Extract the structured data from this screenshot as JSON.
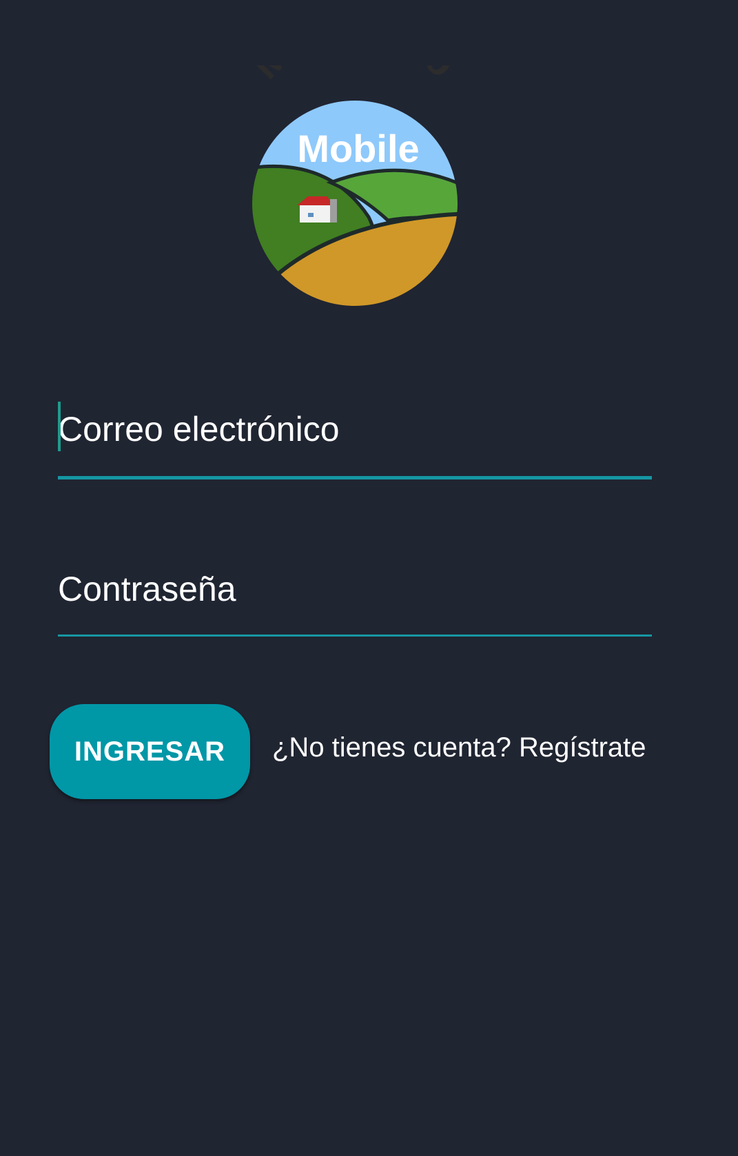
{
  "logo": {
    "arc_text": "MiCampo",
    "main_text": "Mobile",
    "colors": {
      "sky": "#8ec9fb",
      "dark_field": "#417f22",
      "light_field": "#57a63a",
      "wheat_field": "#d09828",
      "outline": "#1e2a2a",
      "arc_text": "#2c2c2c"
    }
  },
  "form": {
    "email_placeholder": "Correo electrónico",
    "password_placeholder": "Contraseña",
    "submit_label": "INGRESAR",
    "register_prompt": "¿No tienes cuenta? Regístrate"
  },
  "theme": {
    "background": "#202532",
    "accent": "#0097a7",
    "underline": "#1597a3",
    "text": "#ffffff"
  }
}
